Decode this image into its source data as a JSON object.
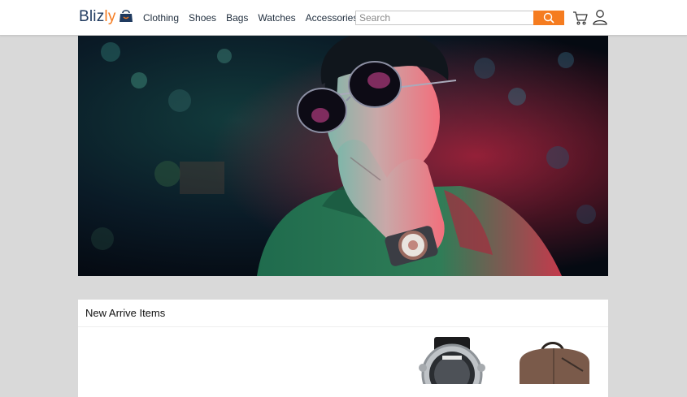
{
  "brand": {
    "name_part1": "Bliz",
    "name_part2": "ly",
    "accent_color": "#f57c20",
    "dark_color": "#1f3a5f"
  },
  "nav": {
    "items": [
      "Clothing",
      "Shoes",
      "Bags",
      "Watches",
      "Accessories"
    ]
  },
  "search": {
    "placeholder": "Search",
    "button_color": "#f57c20"
  },
  "icons": {
    "search": "search-icon",
    "cart": "cart-icon",
    "user": "user-icon",
    "logo": "shopping-bag-icon"
  },
  "hero": {
    "image": "man-with-sunglasses-and-watch"
  },
  "arrivals": {
    "title": "New Arrive Items",
    "products": [
      {
        "image": "wrist-watch"
      },
      {
        "image": "brown-backpack"
      }
    ]
  }
}
